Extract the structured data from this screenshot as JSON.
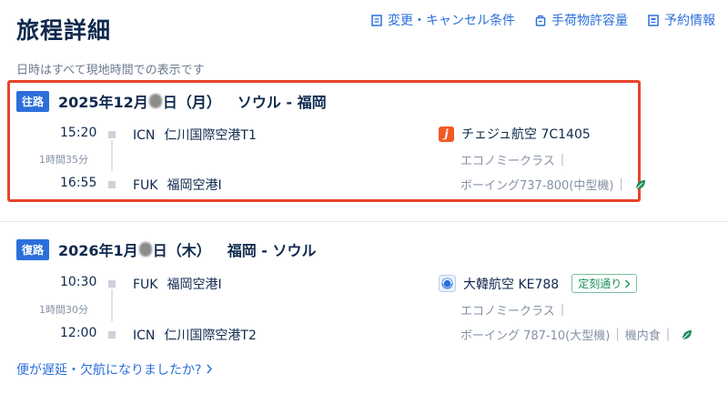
{
  "header": {
    "title": "旅程詳細",
    "links": [
      {
        "label": "変更・キャンセル条件",
        "icon": "document-icon"
      },
      {
        "label": "手荷物許容量",
        "icon": "luggage-icon"
      },
      {
        "label": "予約情報",
        "icon": "receipt-icon"
      }
    ],
    "subtitle": "日時はすべて現地時間での表示です"
  },
  "outbound": {
    "badge": "往路",
    "date_prefix": "2025年12月",
    "date_suffix": "日（月）",
    "route": "ソウル - 福岡",
    "departure": {
      "time": "15:20",
      "code": "ICN",
      "airport": "仁川国際空港T1"
    },
    "duration": "1時間35分",
    "arrival": {
      "time": "16:55",
      "code": "FUK",
      "airport": "福岡空港I"
    },
    "airline": {
      "name": "チェジュ航空 7C1405",
      "logo_letter": "j"
    },
    "cabin": "エコノミークラス",
    "aircraft": "ボーイング737-800(中型機)"
  },
  "return": {
    "badge": "復路",
    "date_prefix": "2026年1月",
    "date_suffix": "日（木）",
    "route": "福岡 - ソウル",
    "departure": {
      "time": "10:30",
      "code": "FUK",
      "airport": "福岡空港I"
    },
    "duration": "1時間30分",
    "arrival": {
      "time": "12:00",
      "code": "ICN",
      "airport": "仁川国際空港T2"
    },
    "airline": {
      "name": "大韓航空 KE788"
    },
    "ontime_label": "定刻通り",
    "cabin": "エコノミークラス",
    "aircraft": "ボーイング 787-10(大型機)",
    "meal": "機内食"
  },
  "footer": {
    "delay_link": "便が遅延・欠航になりましたか?"
  },
  "colors": {
    "accent": "#2c6fdb",
    "highlight": "#e8432b",
    "ontime": "#1d8f5a",
    "eco_leaf": "#1d8f5a"
  }
}
